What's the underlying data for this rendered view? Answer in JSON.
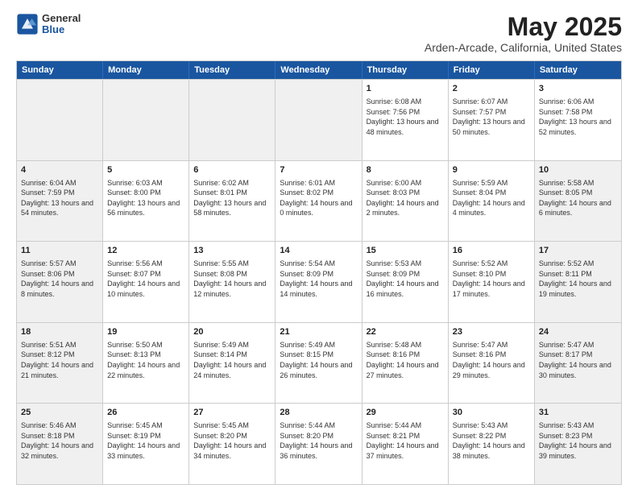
{
  "logo": {
    "general": "General",
    "blue": "Blue"
  },
  "header": {
    "title": "May 2025",
    "location": "Arden-Arcade, California, United States"
  },
  "days": [
    "Sunday",
    "Monday",
    "Tuesday",
    "Wednesday",
    "Thursday",
    "Friday",
    "Saturday"
  ],
  "weeks": [
    [
      {
        "day": "",
        "content": "",
        "shaded": true
      },
      {
        "day": "",
        "content": "",
        "shaded": true
      },
      {
        "day": "",
        "content": "",
        "shaded": true
      },
      {
        "day": "",
        "content": "",
        "shaded": true
      },
      {
        "day": "1",
        "content": "Sunrise: 6:08 AM\nSunset: 7:56 PM\nDaylight: 13 hours\nand 48 minutes.",
        "shaded": false
      },
      {
        "day": "2",
        "content": "Sunrise: 6:07 AM\nSunset: 7:57 PM\nDaylight: 13 hours\nand 50 minutes.",
        "shaded": false
      },
      {
        "day": "3",
        "content": "Sunrise: 6:06 AM\nSunset: 7:58 PM\nDaylight: 13 hours\nand 52 minutes.",
        "shaded": false
      }
    ],
    [
      {
        "day": "4",
        "content": "Sunrise: 6:04 AM\nSunset: 7:59 PM\nDaylight: 13 hours\nand 54 minutes.",
        "shaded": true
      },
      {
        "day": "5",
        "content": "Sunrise: 6:03 AM\nSunset: 8:00 PM\nDaylight: 13 hours\nand 56 minutes.",
        "shaded": false
      },
      {
        "day": "6",
        "content": "Sunrise: 6:02 AM\nSunset: 8:01 PM\nDaylight: 13 hours\nand 58 minutes.",
        "shaded": false
      },
      {
        "day": "7",
        "content": "Sunrise: 6:01 AM\nSunset: 8:02 PM\nDaylight: 14 hours\nand 0 minutes.",
        "shaded": false
      },
      {
        "day": "8",
        "content": "Sunrise: 6:00 AM\nSunset: 8:03 PM\nDaylight: 14 hours\nand 2 minutes.",
        "shaded": false
      },
      {
        "day": "9",
        "content": "Sunrise: 5:59 AM\nSunset: 8:04 PM\nDaylight: 14 hours\nand 4 minutes.",
        "shaded": false
      },
      {
        "day": "10",
        "content": "Sunrise: 5:58 AM\nSunset: 8:05 PM\nDaylight: 14 hours\nand 6 minutes.",
        "shaded": true
      }
    ],
    [
      {
        "day": "11",
        "content": "Sunrise: 5:57 AM\nSunset: 8:06 PM\nDaylight: 14 hours\nand 8 minutes.",
        "shaded": true
      },
      {
        "day": "12",
        "content": "Sunrise: 5:56 AM\nSunset: 8:07 PM\nDaylight: 14 hours\nand 10 minutes.",
        "shaded": false
      },
      {
        "day": "13",
        "content": "Sunrise: 5:55 AM\nSunset: 8:08 PM\nDaylight: 14 hours\nand 12 minutes.",
        "shaded": false
      },
      {
        "day": "14",
        "content": "Sunrise: 5:54 AM\nSunset: 8:09 PM\nDaylight: 14 hours\nand 14 minutes.",
        "shaded": false
      },
      {
        "day": "15",
        "content": "Sunrise: 5:53 AM\nSunset: 8:09 PM\nDaylight: 14 hours\nand 16 minutes.",
        "shaded": false
      },
      {
        "day": "16",
        "content": "Sunrise: 5:52 AM\nSunset: 8:10 PM\nDaylight: 14 hours\nand 17 minutes.",
        "shaded": false
      },
      {
        "day": "17",
        "content": "Sunrise: 5:52 AM\nSunset: 8:11 PM\nDaylight: 14 hours\nand 19 minutes.",
        "shaded": true
      }
    ],
    [
      {
        "day": "18",
        "content": "Sunrise: 5:51 AM\nSunset: 8:12 PM\nDaylight: 14 hours\nand 21 minutes.",
        "shaded": true
      },
      {
        "day": "19",
        "content": "Sunrise: 5:50 AM\nSunset: 8:13 PM\nDaylight: 14 hours\nand 22 minutes.",
        "shaded": false
      },
      {
        "day": "20",
        "content": "Sunrise: 5:49 AM\nSunset: 8:14 PM\nDaylight: 14 hours\nand 24 minutes.",
        "shaded": false
      },
      {
        "day": "21",
        "content": "Sunrise: 5:49 AM\nSunset: 8:15 PM\nDaylight: 14 hours\nand 26 minutes.",
        "shaded": false
      },
      {
        "day": "22",
        "content": "Sunrise: 5:48 AM\nSunset: 8:16 PM\nDaylight: 14 hours\nand 27 minutes.",
        "shaded": false
      },
      {
        "day": "23",
        "content": "Sunrise: 5:47 AM\nSunset: 8:16 PM\nDaylight: 14 hours\nand 29 minutes.",
        "shaded": false
      },
      {
        "day": "24",
        "content": "Sunrise: 5:47 AM\nSunset: 8:17 PM\nDaylight: 14 hours\nand 30 minutes.",
        "shaded": true
      }
    ],
    [
      {
        "day": "25",
        "content": "Sunrise: 5:46 AM\nSunset: 8:18 PM\nDaylight: 14 hours\nand 32 minutes.",
        "shaded": true
      },
      {
        "day": "26",
        "content": "Sunrise: 5:45 AM\nSunset: 8:19 PM\nDaylight: 14 hours\nand 33 minutes.",
        "shaded": false
      },
      {
        "day": "27",
        "content": "Sunrise: 5:45 AM\nSunset: 8:20 PM\nDaylight: 14 hours\nand 34 minutes.",
        "shaded": false
      },
      {
        "day": "28",
        "content": "Sunrise: 5:44 AM\nSunset: 8:20 PM\nDaylight: 14 hours\nand 36 minutes.",
        "shaded": false
      },
      {
        "day": "29",
        "content": "Sunrise: 5:44 AM\nSunset: 8:21 PM\nDaylight: 14 hours\nand 37 minutes.",
        "shaded": false
      },
      {
        "day": "30",
        "content": "Sunrise: 5:43 AM\nSunset: 8:22 PM\nDaylight: 14 hours\nand 38 minutes.",
        "shaded": false
      },
      {
        "day": "31",
        "content": "Sunrise: 5:43 AM\nSunset: 8:23 PM\nDaylight: 14 hours\nand 39 minutes.",
        "shaded": true
      }
    ]
  ]
}
